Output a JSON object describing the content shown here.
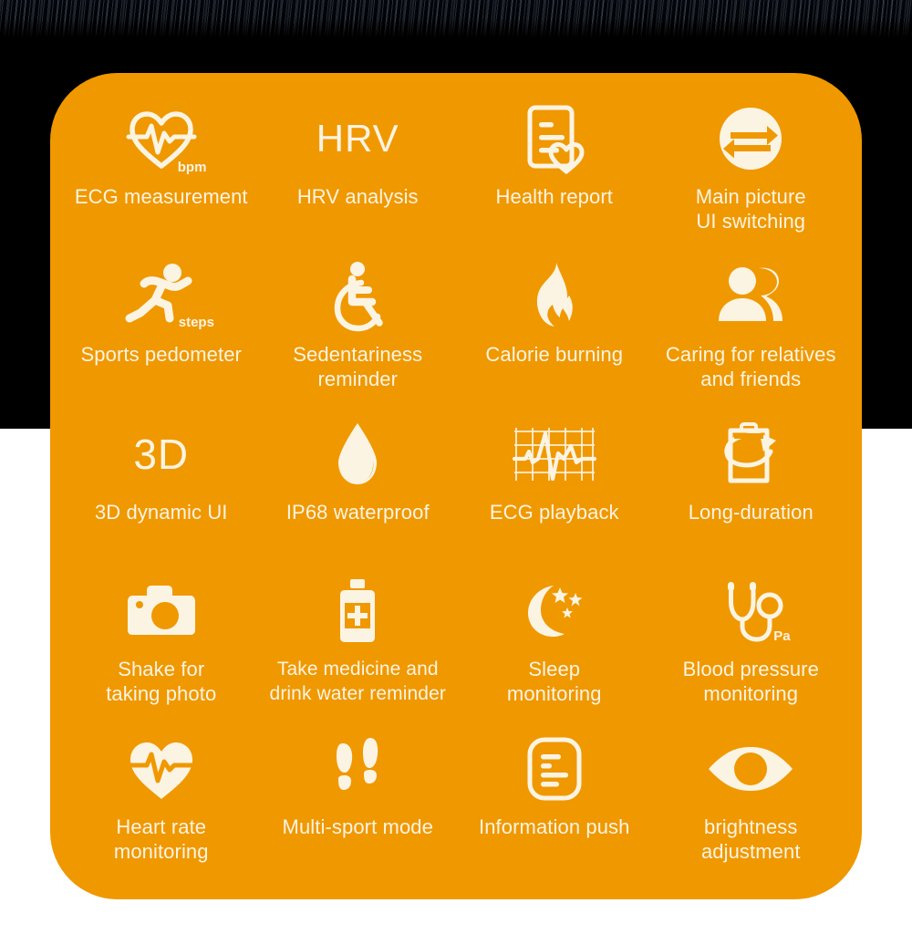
{
  "theme": {
    "card_color": "#F09800",
    "icon_color": "#FCF4E3",
    "label_color": "#FCF4E3",
    "background_top": "#000000",
    "background_bottom": "#FFFFFF"
  },
  "card": {
    "rows": [
      [
        {
          "label": "ECG measurement",
          "icon": "heart-pulse-outline-icon",
          "unit": "bpm"
        },
        {
          "label": "HRV analysis",
          "icon": "hrv-text-icon",
          "icon_text": "HRV"
        },
        {
          "label": "Health report",
          "icon": "document-heart-icon"
        },
        {
          "label": "Main picture\nUI switching",
          "icon": "swap-arrows-circle-icon"
        }
      ],
      [
        {
          "label": "Sports pedometer",
          "icon": "running-person-icon",
          "unit": "steps"
        },
        {
          "label": "Sedentariness\nreminder",
          "icon": "wheelchair-icon"
        },
        {
          "label": "Calorie burning",
          "icon": "flame-icon"
        },
        {
          "label": "Caring for relatives\nand friends",
          "icon": "two-people-icon"
        }
      ],
      [
        {
          "label": "3D dynamic UI",
          "icon": "three-d-text-icon",
          "icon_text": "3D"
        },
        {
          "label": "IP68 waterproof",
          "icon": "water-drop-icon"
        },
        {
          "label": "ECG playback",
          "icon": "ecg-grid-waveform-icon"
        },
        {
          "label": "Long-duration",
          "icon": "battery-refresh-icon"
        }
      ],
      [
        {
          "label": "Shake for\ntaking photo",
          "icon": "camera-icon"
        },
        {
          "label": "Take medicine and\ndrink water reminder",
          "icon": "medicine-bottle-icon"
        },
        {
          "label": "Sleep\nmonitoring",
          "icon": "moon-stars-icon"
        },
        {
          "label": "Blood pressure\nmonitoring",
          "icon": "stethoscope-icon",
          "unit": "Pa"
        }
      ],
      [
        {
          "label": "Heart rate\nmonitoring",
          "icon": "heart-pulse-solid-icon"
        },
        {
          "label": "Multi-sport mode",
          "icon": "footprints-icon"
        },
        {
          "label": "Information push",
          "icon": "message-lines-icon"
        },
        {
          "label": "brightness\nadjustment",
          "icon": "eye-icon"
        }
      ]
    ]
  }
}
